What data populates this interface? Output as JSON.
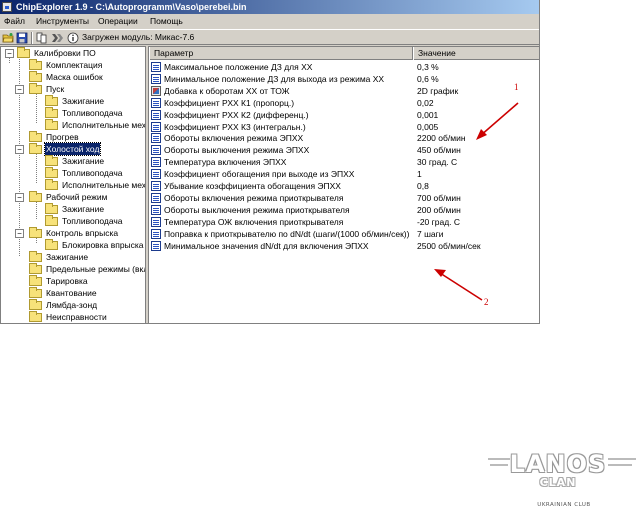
{
  "window": {
    "title": "ChipExplorer  1.9 - C:\\Autoprogramm\\Vaso\\perebei.bin"
  },
  "menu": [
    "Файл",
    "Инструменты",
    "Операции",
    "Помощь"
  ],
  "toolbar": {
    "status": "Загружен модуль: Микас-7.6",
    "icons": [
      "open-icon",
      "save-icon",
      "compare-icon",
      "blocks-icon",
      "info-icon"
    ]
  },
  "tree": {
    "items": [
      {
        "label": "Калибровки ПО",
        "level": 0,
        "expander": "minus"
      },
      {
        "label": "Комплектация",
        "level": 1
      },
      {
        "label": "Маска ошибок",
        "level": 1
      },
      {
        "label": "Пуск",
        "level": 1,
        "expander": "minus"
      },
      {
        "label": "Зажигание",
        "level": 2
      },
      {
        "label": "Топливоподача",
        "level": 2
      },
      {
        "label": "Исполнительные меха",
        "level": 2
      },
      {
        "label": "Прогрев",
        "level": 1
      },
      {
        "label": "Холостой ход",
        "level": 1,
        "expander": "minus",
        "selected": true
      },
      {
        "label": "Зажигание",
        "level": 2
      },
      {
        "label": "Топливоподача",
        "level": 2
      },
      {
        "label": "Исполнительные меха",
        "level": 2
      },
      {
        "label": "Рабочий режим",
        "level": 1,
        "expander": "minus"
      },
      {
        "label": "Зажигание",
        "level": 2
      },
      {
        "label": "Топливоподача",
        "level": 2
      },
      {
        "label": "Контроль впрыска",
        "level": 1,
        "expander": "minus"
      },
      {
        "label": "Блокировка впрыска",
        "level": 2
      },
      {
        "label": "Зажигание",
        "level": 1
      },
      {
        "label": "Предельные режимы (вкл",
        "level": 1
      },
      {
        "label": "Тарировка",
        "level": 1
      },
      {
        "label": "Квантование",
        "level": 1
      },
      {
        "label": "Лямбда-зонд",
        "level": 1
      },
      {
        "label": "Неисправности",
        "level": 1
      }
    ]
  },
  "list": {
    "headers": {
      "param": "Параметр",
      "value": "Значение"
    },
    "rows": [
      {
        "name": "Максимальное положение ДЗ для ХХ",
        "value": "0,3 %",
        "icon": "table-icon"
      },
      {
        "name": "Минимальное положение ДЗ для выхода из режима ХХ",
        "value": "0,6 %",
        "icon": "table-icon"
      },
      {
        "name": "Добавка к оборотам ХХ от ТОЖ",
        "value": "2D график",
        "icon": "graph-icon"
      },
      {
        "name": "Коэффициент РХХ К1 (пропорц.)",
        "value": "0,02",
        "icon": "table-icon"
      },
      {
        "name": "Коэффициент РХХ К2 (дифференц.)",
        "value": "0,001",
        "icon": "table-icon"
      },
      {
        "name": "Коэффициент РХХ К3 (интегральн.)",
        "value": "0,005",
        "icon": "table-icon"
      },
      {
        "name": "Обороты включения режима ЭПХХ",
        "value": "2200 об/мин",
        "icon": "table-icon"
      },
      {
        "name": "Обороты выключения режима ЭПХХ",
        "value": "450 об/мин",
        "icon": "table-icon"
      },
      {
        "name": "Температура включения ЭПХХ",
        "value": "30 град. С",
        "icon": "table-icon"
      },
      {
        "name": "Коэффициент обогащения при выходе из ЭПХХ",
        "value": "1",
        "icon": "table-icon"
      },
      {
        "name": "Убывание коэффициента обогащения ЭПХХ",
        "value": "0,8",
        "icon": "table-icon"
      },
      {
        "name": "Обороты включения режима приоткрывателя",
        "value": "700 об/мин",
        "icon": "table-icon"
      },
      {
        "name": "Обороты выключения режима приоткрывателя",
        "value": "200 об/мин",
        "icon": "table-icon"
      },
      {
        "name": "Температура ОЖ включения приоткрывателя",
        "value": "-20 град. С",
        "icon": "table-icon"
      },
      {
        "name": "Поправка к приоткрывателю по dN/dt (шаги/(1000 об/мин/сек))",
        "value": "7 шаги",
        "icon": "table-icon"
      },
      {
        "name": "Минимальное значения dN/dt для включения ЭПХХ",
        "value": "2500 об/мин/сек",
        "icon": "table-icon"
      }
    ]
  },
  "annotations": {
    "arrow_color": "#cc0000",
    "labels": [
      "1",
      "2"
    ]
  },
  "watermark": {
    "main": "LANOS",
    "sub": "CLAN",
    "tag": "UKRAINIAN CLUB"
  }
}
